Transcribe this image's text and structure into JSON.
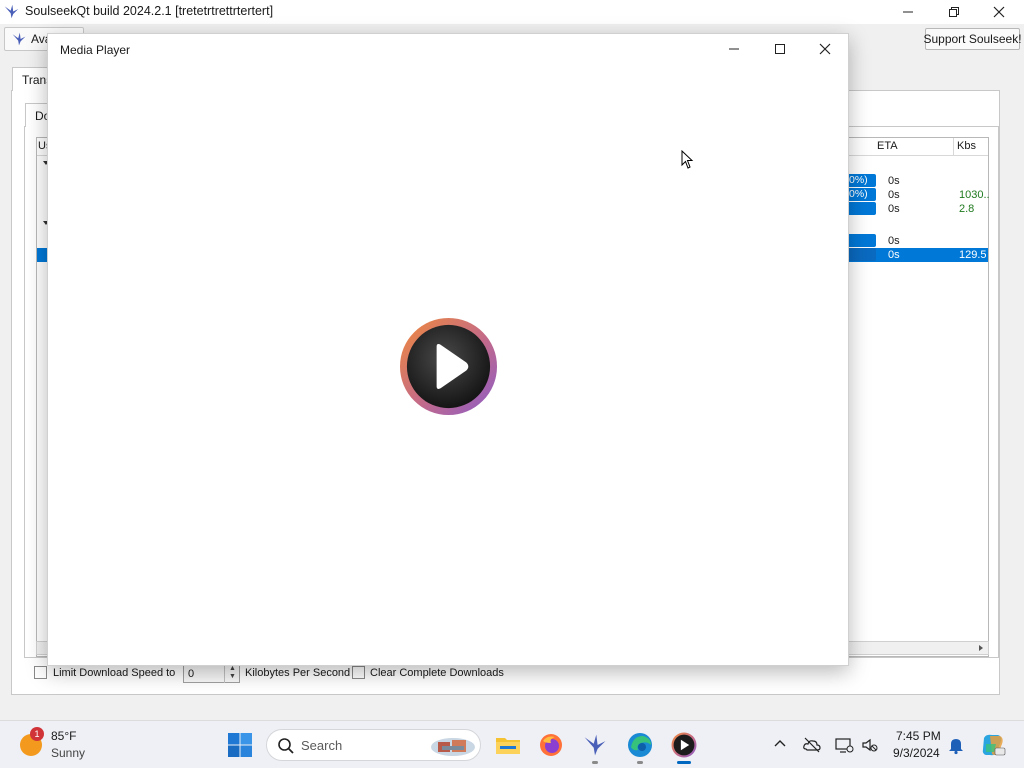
{
  "main_window": {
    "title": "SoulseekQt build 2024.2.1 [tretetrtrettrtertert]",
    "available_label": "Ava",
    "support_label": "Support Soulseek!",
    "outer_tab_label": "Trans",
    "inner_tab_label": "Do"
  },
  "table": {
    "columns": {
      "user": "Us",
      "eta": "ETA",
      "kbs": "Kbs"
    },
    "rows": [
      {
        "progress": "0%)",
        "eta": "0s",
        "kbs": ""
      },
      {
        "progress": "0%)",
        "eta": "0s",
        "kbs": "1030..."
      },
      {
        "progress": "",
        "eta": "0s",
        "kbs": "2.8"
      },
      {
        "progress": "",
        "eta": "0s",
        "kbs": ""
      },
      {
        "progress": "",
        "eta": "0s",
        "kbs": "129.5"
      }
    ]
  },
  "bottom": {
    "limit_label": "Limit Download Speed to",
    "speed_value": "0",
    "units_label": "Kilobytes Per Second",
    "clear_label": "Clear Complete Downloads"
  },
  "media_player": {
    "title": "Media Player"
  },
  "taskbar": {
    "weather_badge": "1",
    "weather_temp": "85°F",
    "weather_condition": "Sunny",
    "search_placeholder": "Search",
    "time": "7:45 PM",
    "date": "9/3/2024"
  },
  "colors": {
    "accent": "#0078d7",
    "kbs_green": "#1f7a1f",
    "media_player_ring_start": "#e8813a",
    "media_player_ring_end": "#8a5cc8"
  },
  "icons": [
    "soulseek-bird-icon",
    "minimize-icon",
    "maximize-icon",
    "close-icon",
    "play-icon",
    "windows-start-icon",
    "search-icon",
    "file-explorer-icon",
    "firefox-icon",
    "edge-icon",
    "media-player-icon",
    "chevron-up-icon",
    "onedrive-icon",
    "network-icon",
    "volume-icon",
    "notification-bell-icon",
    "copilot-icon"
  ]
}
